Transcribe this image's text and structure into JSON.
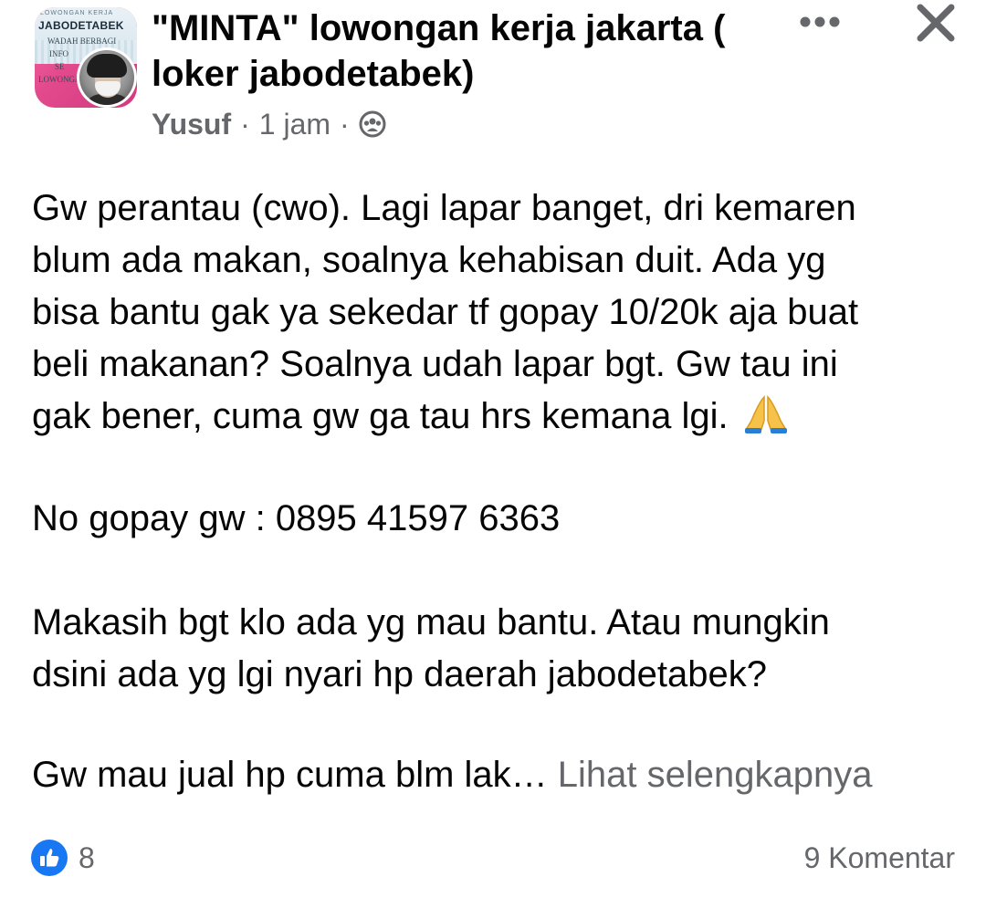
{
  "header": {
    "group_name": "\"MINTA\" lowongan kerja jakarta ( loker jabodetabek)",
    "group_avatar_text": {
      "small": "LOWONGAN KERJA",
      "main": "JABODETABEK",
      "sub": "WADAH BERBAGI INFO",
      "line1": "WADAH BERBAGI",
      "line2": "INFO",
      "line3": "SE",
      "line4": "LOWONGAN"
    },
    "author": "Yusuf",
    "separator": "·",
    "time": "1 jam",
    "audience_icon": "group-icon",
    "more_icon": "more-icon",
    "close_icon": "close-icon"
  },
  "post": {
    "paragraph1": "Gw perantau (cwo). Lagi lapar banget, dri kemaren\nblum ada makan, soalnya kehabisan duit. Ada yg\nbisa bantu gak ya sekedar tf gopay 10/20k aja buat\nbeli makanan? Soalnya udah lapar bgt. Gw tau ini\ngak bener, cuma gw ga tau hrs kemana lgi.",
    "paragraph1_emoji": "folded-hands-emoji",
    "paragraph2": "No gopay gw : 0895 41597 6363",
    "paragraph3": "Makasih bgt klo ada yg mau bantu. Atau mungkin\ndsini ada yg lgi nyari hp daerah jabodetabek?",
    "paragraph4": "Gw mau jual hp cuma blm lak… ",
    "see_more": "Lihat selengkapnya"
  },
  "footer": {
    "reaction_icon": "like-icon",
    "reaction_count": "8",
    "comments": "9 Komentar"
  },
  "colors": {
    "text": "#050505",
    "secondary": "#65676b",
    "like_blue": "#1877f2",
    "avatar_pink": "#e24a8d"
  }
}
